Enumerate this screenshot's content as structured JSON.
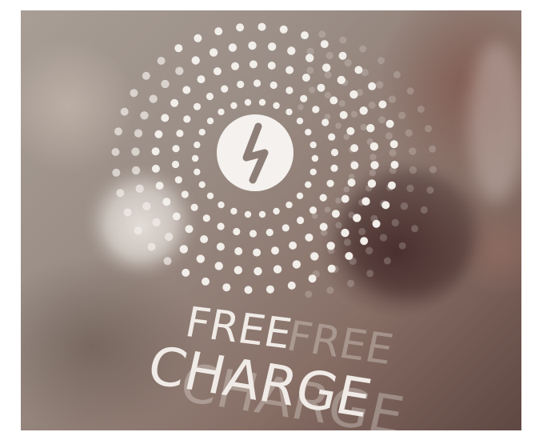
{
  "sign": {
    "line1": "FREE",
    "line2": "CHARGE",
    "icon": "lightning-bolt-icon",
    "pattern": "dotted-sunburst"
  },
  "colors": {
    "sticker_white": "#f2eeea",
    "bolt_grey": "#8d7f78",
    "glass_warm": "#9a8d85",
    "shadow_dark": "#5f4742"
  }
}
